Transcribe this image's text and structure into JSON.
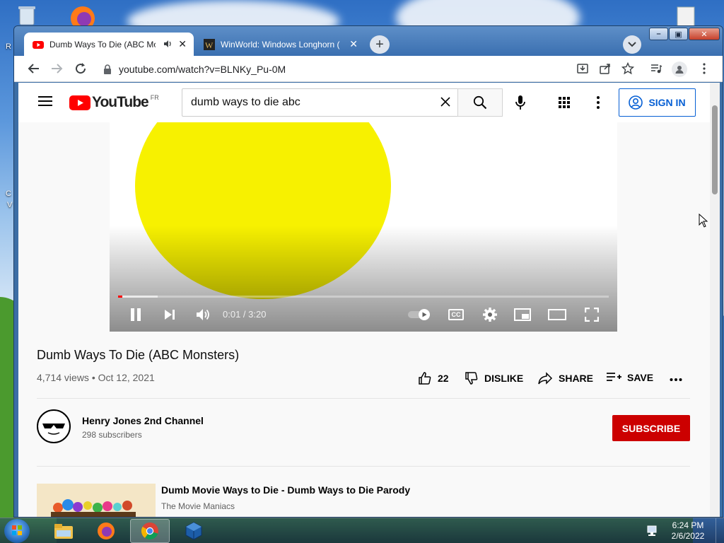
{
  "browser": {
    "tabs": [
      {
        "title": "Dumb Ways To Die (ABC Mo",
        "active": true,
        "audio": true
      },
      {
        "title": "WinWorld: Windows Longhorn (",
        "active": false,
        "audio": false
      }
    ],
    "new_tab_symbol": "+",
    "url": "youtube.com/watch?v=BLNKy_Pu-0M"
  },
  "youtube": {
    "logo_text": "YouTube",
    "region": "FR",
    "search_value": "dumb ways to die abc",
    "sign_in_label": "SIGN IN",
    "player": {
      "time": "0:01 / 3:20",
      "played_fraction": 0.008,
      "buffered_fraction": 0.08,
      "cc_label": "CC"
    },
    "video": {
      "title": "Dumb Ways To Die (ABC Monsters)",
      "meta": "4,714 views • Oct 12, 2021",
      "likes": "22",
      "dislike_label": "DISLIKE",
      "share_label": "SHARE",
      "save_label": "SAVE"
    },
    "channel": {
      "name": "Henry Jones 2nd Channel",
      "subscribers": "298 subscribers",
      "subscribe_label": "SUBSCRIBE"
    },
    "recommended": [
      {
        "title": "Dumb Movie Ways to Die - Dumb Ways to Die Parody",
        "channel": "The Movie Maniacs"
      }
    ]
  },
  "taskbar": {
    "time": "6:24 PM",
    "date": "2/6/2022"
  },
  "colors": {
    "youtube_red": "#ff0000",
    "subscribe_red": "#cc0000",
    "link_blue": "#065fd4",
    "sun_yellow": "#f7f100"
  }
}
